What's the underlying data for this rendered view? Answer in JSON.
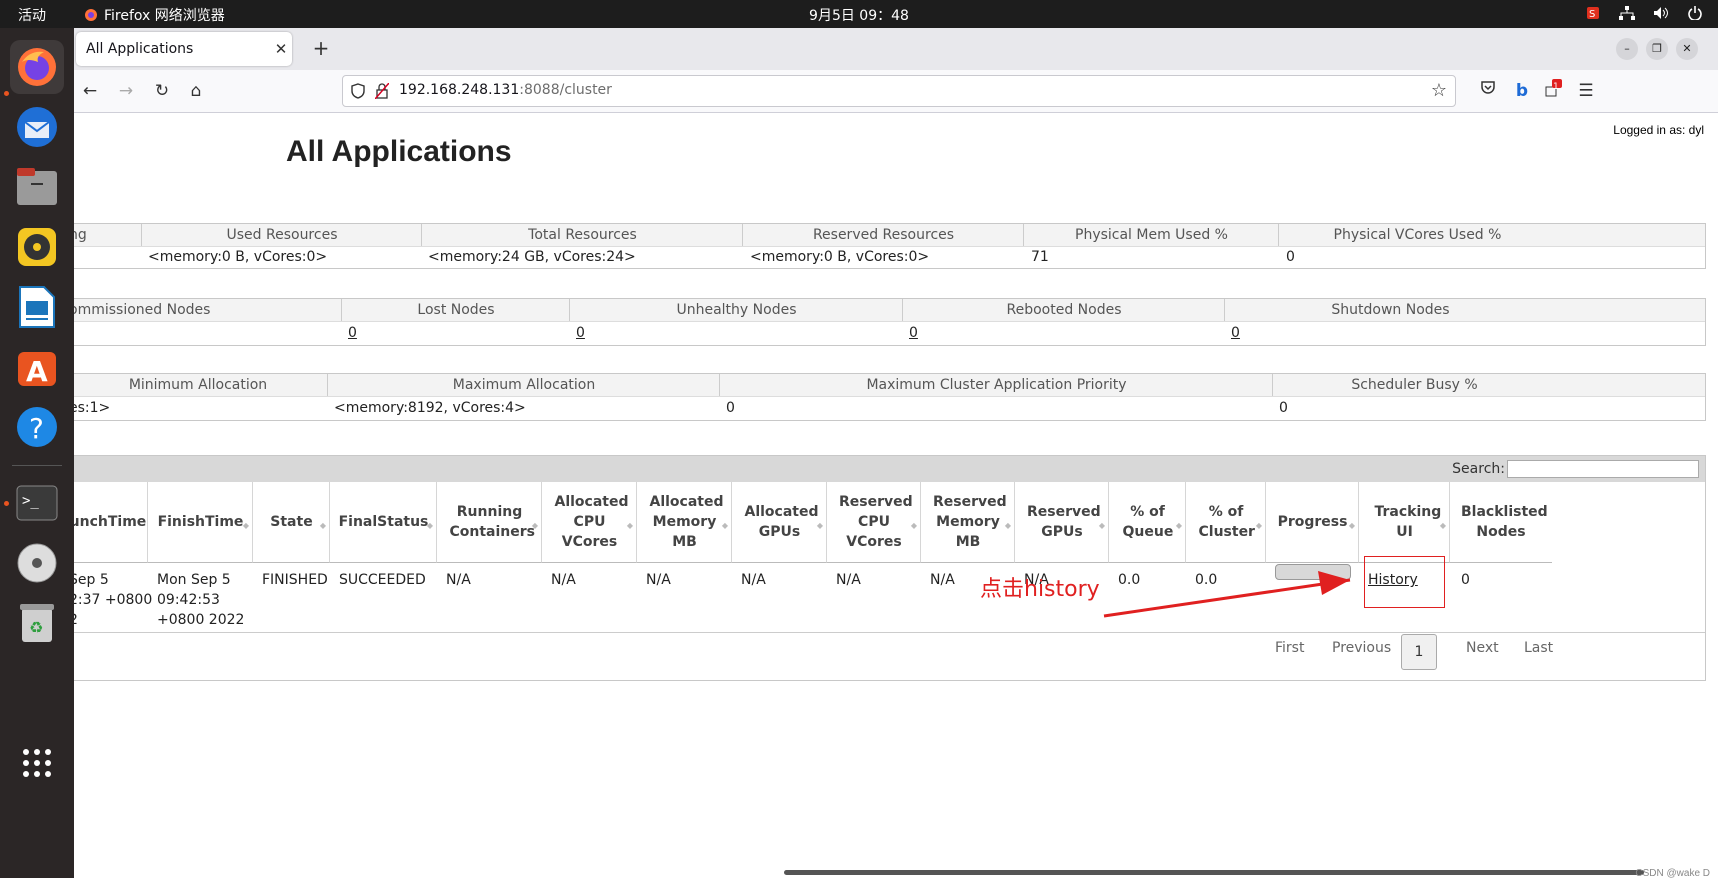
{
  "topbar": {
    "activities": "活动",
    "app_name": "Firefox 网络浏览器",
    "clock": "9月5日  09：48"
  },
  "dock": {
    "items": [
      "firefox-icon",
      "thunderbird-icon",
      "files-icon",
      "rhythmbox-icon",
      "libreoffice-writer-icon",
      "app-center-icon",
      "help-icon",
      "terminal-icon",
      "dvd-icon",
      "trash-icon",
      "app-grid-icon"
    ]
  },
  "browser": {
    "tab_title": "All Applications",
    "url_host": "192.168.248.131",
    "url_rest": ":8088/cluster",
    "badge_count": "1"
  },
  "page": {
    "logged_in": "Logged in as: dyl",
    "title": "All Applications",
    "metrics1": {
      "headers": [
        "ng",
        "Used Resources",
        "Total Resources",
        "Reserved Resources",
        "Physical Mem Used %",
        "Physical VCores Used %"
      ],
      "values": [
        "",
        "<memory:0 B, vCores:0>",
        "<memory:24 GB, vCores:24>",
        "<memory:0 B, vCores:0>",
        "71",
        "0"
      ]
    },
    "metrics2": {
      "headers": [
        "ommissioned Nodes",
        "Lost Nodes",
        "Unhealthy Nodes",
        "Rebooted Nodes",
        "Shutdown Nodes"
      ],
      "values": [
        "",
        "0",
        "0",
        "0",
        "0"
      ]
    },
    "metrics3": {
      "headers": [
        "Minimum Allocation",
        "Maximum Allocation",
        "Maximum Cluster Application Priority",
        "Scheduler Busy %"
      ],
      "values": [
        "es:1>",
        "<memory:8192, vCores:4>",
        "0",
        "0"
      ]
    },
    "apps": {
      "search_label": "Search:",
      "headers": [
        "unchTime",
        "FinishTime",
        "State",
        "FinalStatus",
        "Running Containers",
        "Allocated CPU VCores",
        "Allocated Memory MB",
        "Allocated GPUs",
        "Reserved CPU VCores",
        "Reserved Memory MB",
        "Reserved GPUs",
        "% of Queue",
        "% of Cluster",
        "Progress",
        "Tracking UI",
        "Blacklisted Nodes"
      ],
      "row": {
        "launch_time": "Sep 5\n2:37 +0800\n2",
        "finish_time": "Mon Sep 5\n09:42:53\n+0800 2022",
        "state": "FINISHED",
        "final_status": "SUCCEEDED",
        "running_containers": "N/A",
        "alloc_cpu": "N/A",
        "alloc_mem": "N/A",
        "alloc_gpu": "N/A",
        "res_cpu": "N/A",
        "res_mem": "N/A",
        "res_gpu": "N/A",
        "pct_queue": "0.0",
        "pct_cluster": "0.0",
        "progress": 0,
        "tracking_ui": "History",
        "blacklisted": "0"
      },
      "pager": {
        "first": "First",
        "previous": "Previous",
        "current": "1",
        "next": "Next",
        "last": "Last"
      }
    },
    "annotation": "点击history",
    "watermark": "CSDN @wake D"
  },
  "colors": {
    "annotation": "#e02020",
    "dock_bg": "#2b2626",
    "topbar_bg": "#1d1d1d"
  }
}
